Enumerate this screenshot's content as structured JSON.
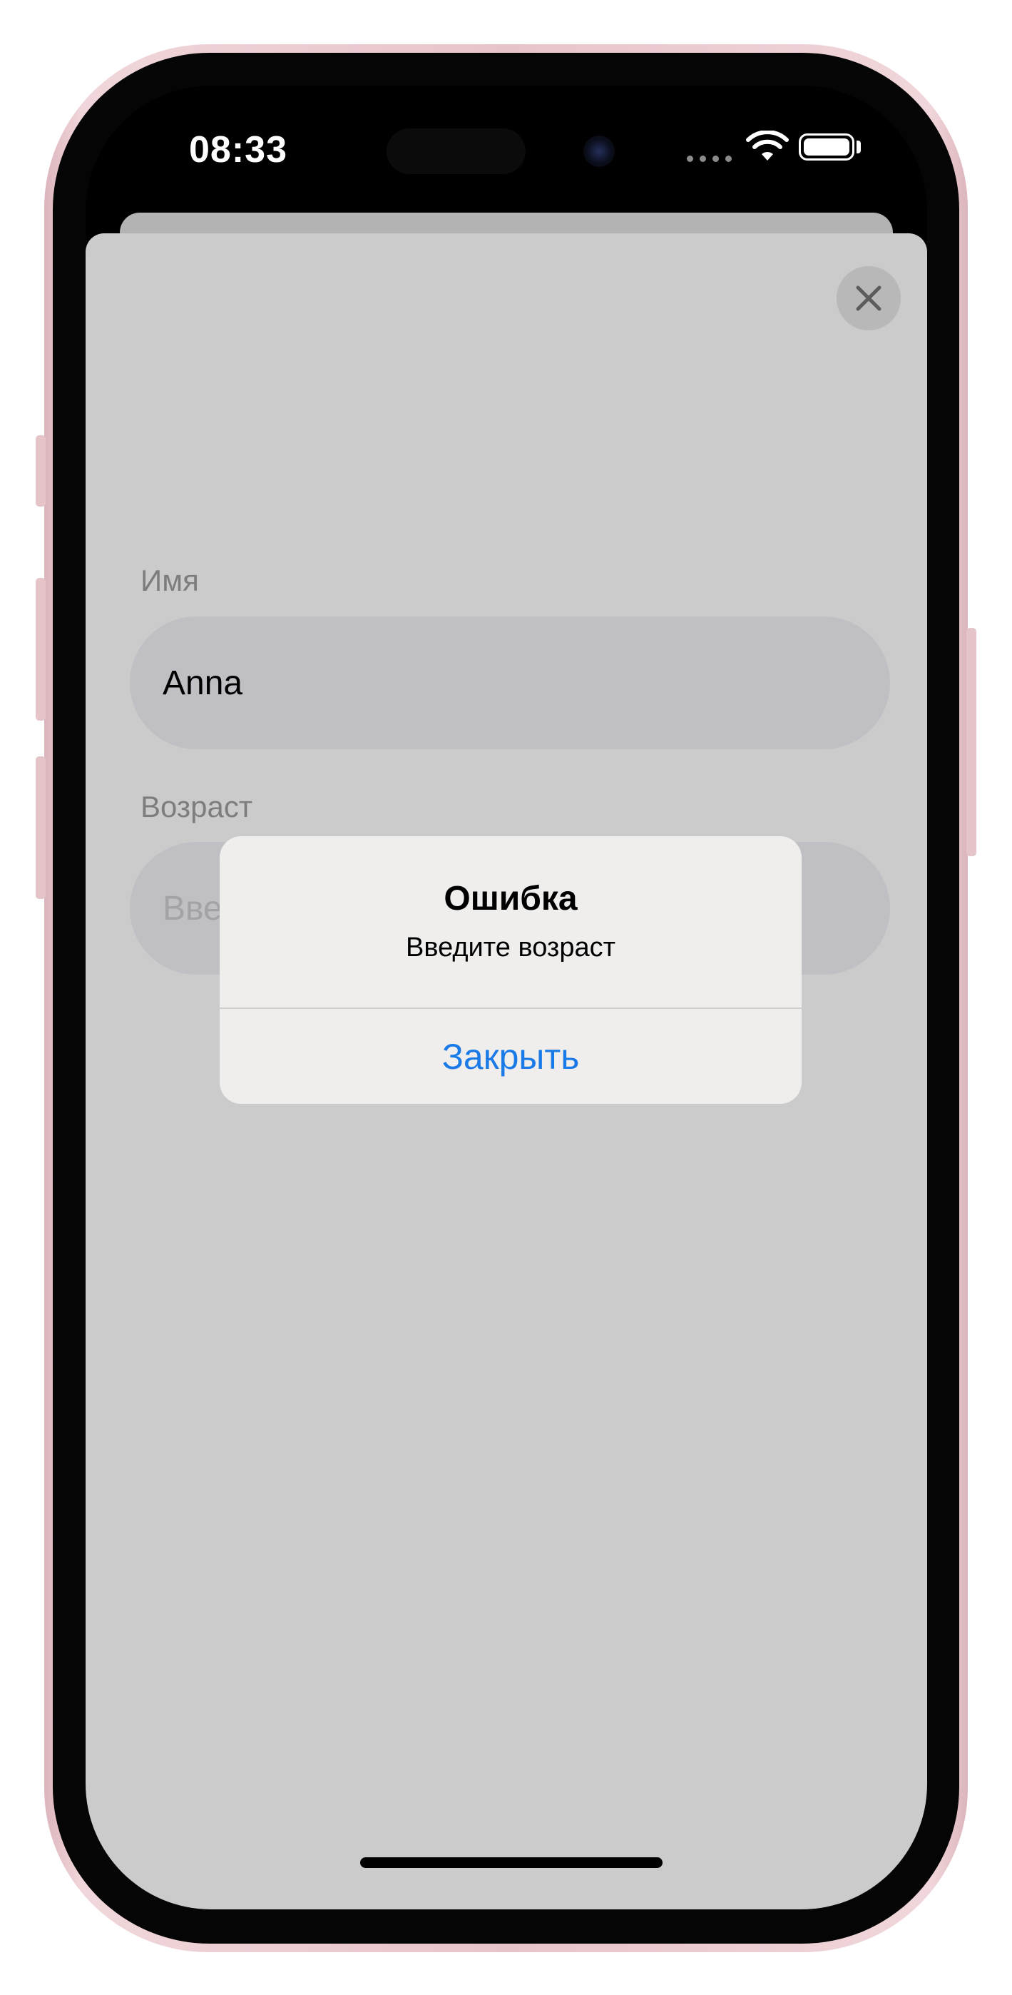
{
  "status_bar": {
    "time": "08:33",
    "icons": [
      "cellular-dots-icon",
      "wifi-icon",
      "battery-icon"
    ]
  },
  "sheet": {
    "close_icon": "close-icon",
    "fields": [
      {
        "label": "Имя",
        "value": "Anna",
        "placeholder": ""
      },
      {
        "label": "Возраст",
        "value": "",
        "placeholder": "Введите возраст"
      }
    ]
  },
  "alert": {
    "title": "Ошибка",
    "message": "Введите возраст",
    "action_label": "Закрыть"
  },
  "colors": {
    "accent": "#1a7ae8",
    "sheet_bg": "#cbcbcb",
    "field_bg": "#c0bfc3",
    "alert_bg": "#efeeed",
    "device_frame": "#e7c4ca"
  }
}
